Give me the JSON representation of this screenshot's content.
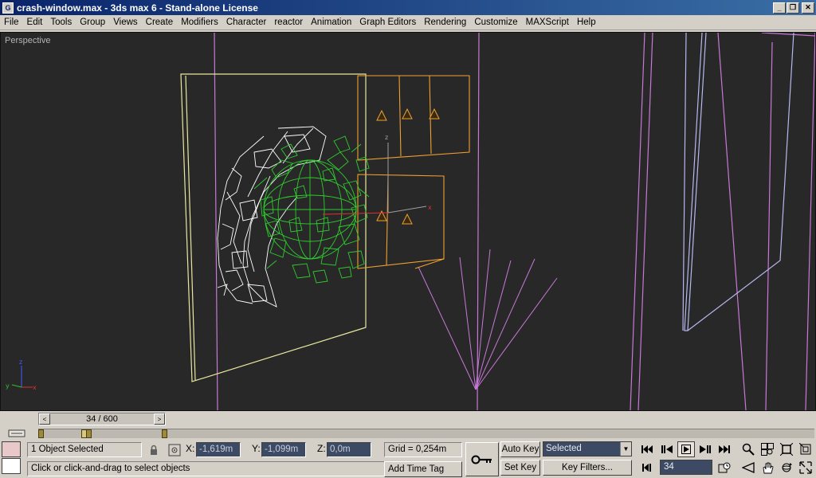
{
  "window": {
    "title": "crash-window.max - 3ds max 6 - Stand-alone License",
    "app_icon": "G",
    "minimize": "_",
    "restore": "❐",
    "close": "✕"
  },
  "menu": [
    "File",
    "Edit",
    "Tools",
    "Group",
    "Views",
    "Create",
    "Modifiers",
    "Character",
    "reactor",
    "Animation",
    "Graph Editors",
    "Rendering",
    "Customize",
    "MAXScript",
    "Help"
  ],
  "viewport": {
    "label": "Perspective",
    "axis_labels": {
      "x": "x",
      "y": "y",
      "z": "z"
    }
  },
  "timeslider": {
    "value": "34 / 600",
    "prev": "<",
    "next": ">"
  },
  "status": {
    "selection": "1 Object Selected",
    "prompt": "Click or click-and-drag to select objects",
    "x_label": "X:",
    "y_label": "Y:",
    "z_label": "Z:",
    "x_value": "-1,619m",
    "y_value": "-1,099m",
    "z_value": "0,0m",
    "grid": "Grid = 0,254m",
    "add_time_tag": "Add Time Tag"
  },
  "animation": {
    "auto_key": "Auto Key",
    "set_key": "Set Key",
    "selected": "Selected",
    "key_filters": "Key Filters...",
    "current_frame": "34"
  },
  "colors": {
    "viewport_bg": "#282828",
    "wire_white": "#ffffff",
    "wire_green": "#2ecc2e",
    "wire_orange": "#f0a030",
    "wire_yellow": "#e8e8a0",
    "wire_purple": "#c878d8",
    "wire_lavender": "#b8b8f0",
    "swatch_top": "#e8c8c8",
    "swatch_bottom": "#ffffff"
  }
}
